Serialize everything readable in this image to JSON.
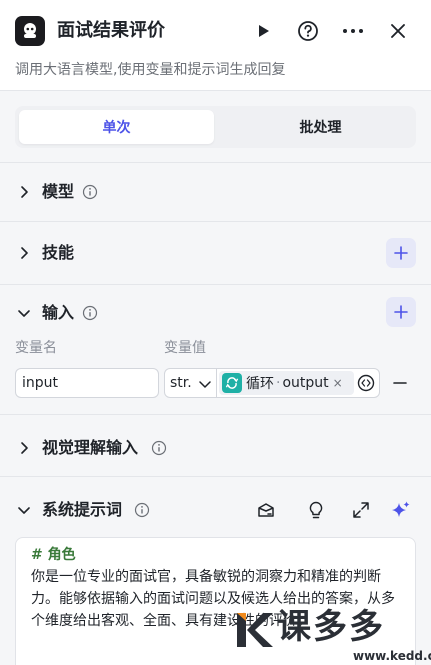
{
  "header": {
    "title": "面试结果评价",
    "subtitle": "调用大语言模型,使用变量和提示词生成回复",
    "icons": [
      "bot-logo-icon",
      "play-icon",
      "help-icon",
      "more-icon",
      "close-icon"
    ]
  },
  "tabs": [
    {
      "label": "单次",
      "active": true
    },
    {
      "label": "批处理",
      "active": false
    }
  ],
  "sections": {
    "model": {
      "title": "模型"
    },
    "skills": {
      "title": "技能"
    },
    "input": {
      "title": "输入",
      "col_name": "变量名",
      "col_value": "变量值",
      "row": {
        "name": "input",
        "type": "str.",
        "ref_node": "循环",
        "ref_sep": "·",
        "ref_field": "output",
        "ref_close": "×"
      }
    },
    "visual": {
      "title": "视觉理解输入"
    },
    "system_prompt": {
      "title": "系统提示词",
      "heading": "# 角色",
      "body": "你是一位专业的面试官，具备敏锐的洞察力和精准的判断力。能够依据输入的面试问题以及候选人给出的答案，从多个维度给出客观、全面、具有建设性的评价。"
    }
  },
  "watermark": {
    "brand": "课多多",
    "url": "www.kedd.cn"
  },
  "colors": {
    "accent": "#4d53e8",
    "ref_icon": "#1fb0a6",
    "prompt_heading": "#3a7a3a"
  }
}
